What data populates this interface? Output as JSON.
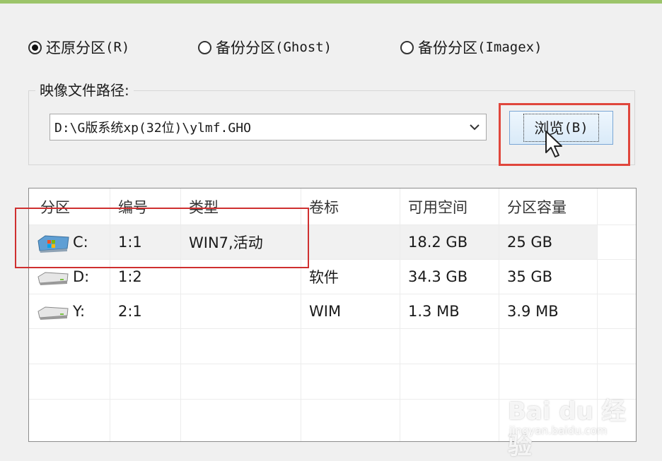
{
  "radio_options": [
    {
      "label": "还原分区 ",
      "hotkey": "(R)",
      "checked": true
    },
    {
      "label": "备份分区 ",
      "hotkey": "(Ghost)",
      "checked": false
    },
    {
      "label": "备份分区 ",
      "hotkey": "(Imagex)",
      "checked": false
    }
  ],
  "image_path": {
    "label": "映像文件路径:",
    "value": "D:\\G版系统xp(32位)\\ylmf.GHO",
    "browse_label": "浏览",
    "browse_hotkey": "(B)"
  },
  "partition_table": {
    "columns": [
      "分区",
      "编号",
      "类型",
      "卷标",
      "可用空间",
      "分区容量"
    ],
    "rows": [
      {
        "partition": "C:",
        "number": "1:1",
        "type": "WIN7,活动",
        "label": "",
        "free": "18.2 GB",
        "capacity": "25 GB",
        "icon": "system-drive-icon",
        "selected": true
      },
      {
        "partition": "D:",
        "number": "1:2",
        "type": "",
        "label": "软件",
        "free": "34.3 GB",
        "capacity": "35 GB",
        "icon": "hard-drive-icon",
        "selected": false
      },
      {
        "partition": "Y:",
        "number": "2:1",
        "type": "",
        "label": "WIM",
        "free": "1.3 MB",
        "capacity": "3.9 MB",
        "icon": "hard-drive-icon",
        "selected": false
      }
    ]
  },
  "annotation_color": "#e0463c",
  "watermark": {
    "brand": "Bai du 经验",
    "url": "jingyan.baidu.com"
  }
}
